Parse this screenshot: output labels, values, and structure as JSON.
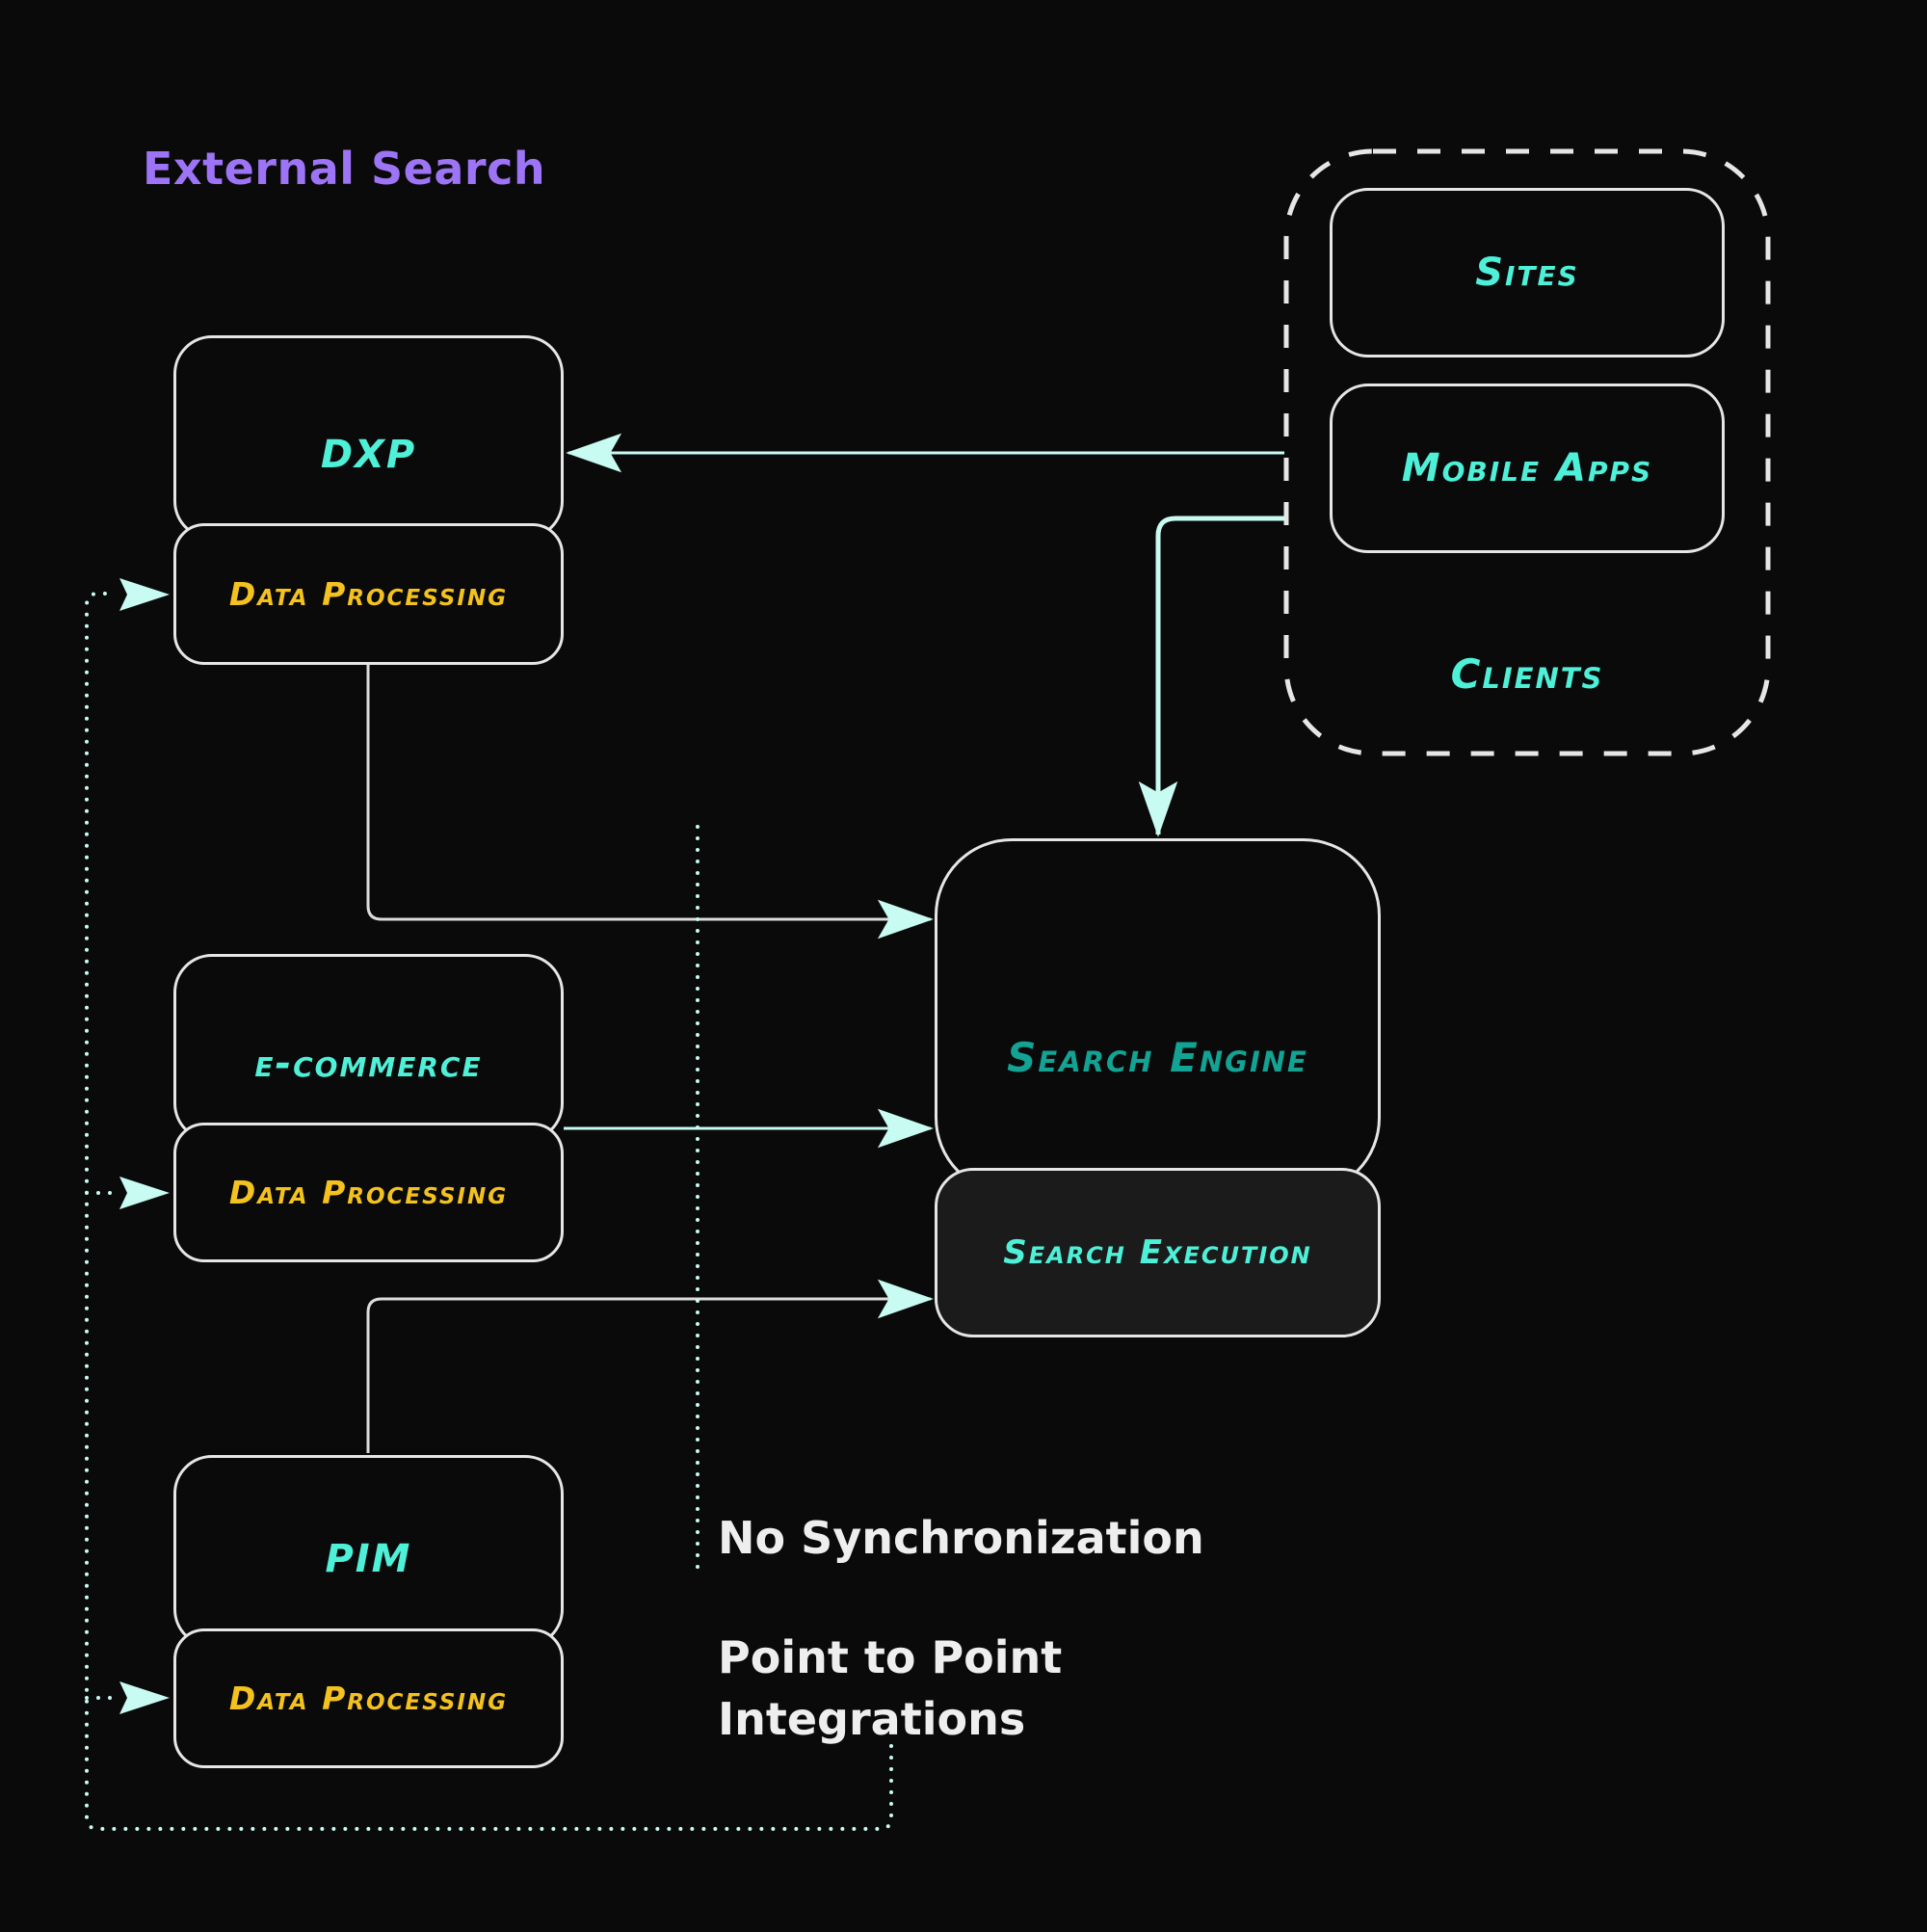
{
  "title": "External Search",
  "colors": {
    "background": "#0a0a0a",
    "title": "#9d74f5",
    "system_label": "#4ef0d8",
    "engine_label": "#12a394",
    "processing_label": "#f4c21f",
    "box_border": "#e6e6e6",
    "arrow": "#c8fbf2",
    "note_text": "#eeeeee"
  },
  "systems": [
    {
      "id": "dxp",
      "label": "DXP",
      "sub_label": "Data Processing"
    },
    {
      "id": "ecommerce",
      "label": "e-commerce",
      "sub_label": "Data Processing"
    },
    {
      "id": "pim",
      "label": "PIM",
      "sub_label": "Data Processing"
    }
  ],
  "search_engine": {
    "label": "Search Engine",
    "sub_label": "Search Execution"
  },
  "clients": {
    "group_label": "Clients",
    "items": [
      {
        "label": "Sites"
      },
      {
        "label": "Mobile Apps"
      }
    ]
  },
  "notes": {
    "no_sync": "No Synchronization",
    "p2p_line1": "Point to Point",
    "p2p_line2": "Integrations"
  },
  "edges": [
    {
      "from": "clients",
      "to": "dxp",
      "style": "solid"
    },
    {
      "from": "clients",
      "to": "search_engine",
      "style": "solid"
    },
    {
      "from": "dxp",
      "to": "search_engine",
      "style": "solid"
    },
    {
      "from": "ecommerce",
      "to": "search_engine",
      "style": "solid"
    },
    {
      "from": "pim",
      "to": "search_execution",
      "style": "solid"
    },
    {
      "from": "point_to_point_note",
      "to": "dxp_data_processing",
      "style": "dotted"
    },
    {
      "from": "point_to_point_note",
      "to": "ecommerce_data_processing",
      "style": "dotted"
    },
    {
      "from": "point_to_point_note",
      "to": "pim_data_processing",
      "style": "dotted"
    }
  ]
}
